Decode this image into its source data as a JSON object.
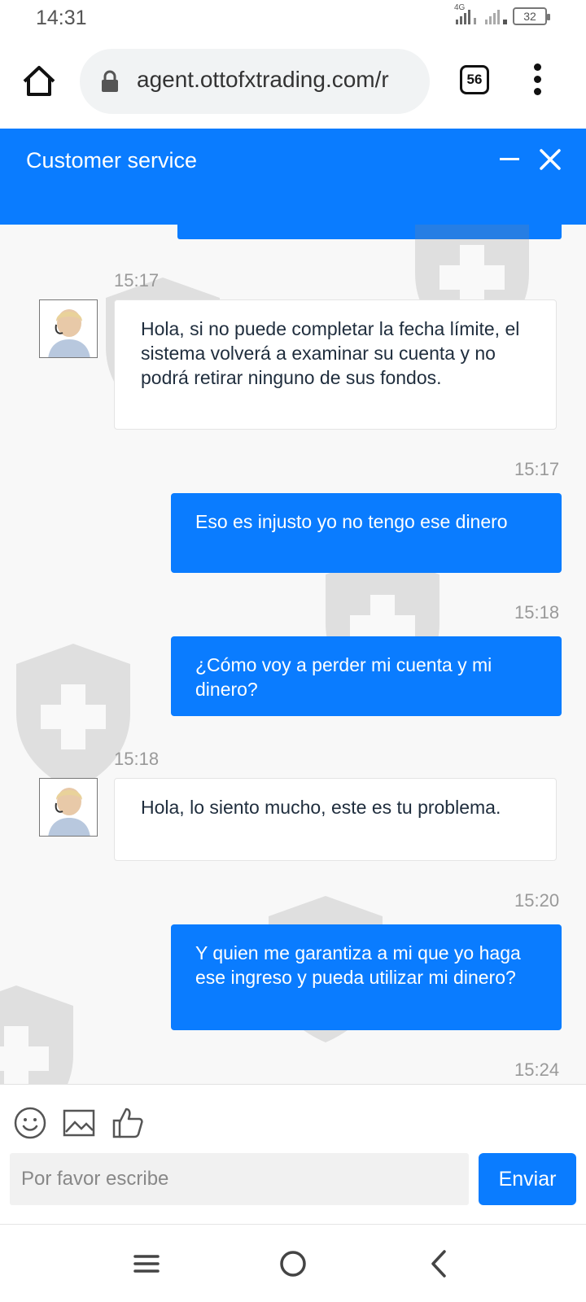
{
  "status_bar": {
    "time": "14:31",
    "network_label": "4G",
    "battery": "32"
  },
  "browser": {
    "url": "agent.ottofxtrading.com/r",
    "tab_count": "56"
  },
  "chat": {
    "title": "Customer service",
    "messages": [
      {
        "direction": "incoming",
        "time": "15:17",
        "text": "Hola, si no puede completar la fecha límite, el sistema volverá a examinar su cuenta y no podrá retirar ninguno de sus fondos."
      },
      {
        "direction": "outgoing",
        "time": "15:17",
        "text": "Eso es injusto yo no tengo ese dinero"
      },
      {
        "direction": "outgoing",
        "time": "15:18",
        "text": "¿Cómo voy a perder mi cuenta y mi dinero?"
      },
      {
        "direction": "incoming",
        "time": "15:18",
        "text": "Hola, lo siento mucho, este es tu problema."
      },
      {
        "direction": "outgoing",
        "time": "15:20",
        "text": "Y quien me garantiza a mi que yo haga ese ingreso y pueda utilizar mi dinero?"
      },
      {
        "direction": "outgoing",
        "time": "15:24",
        "text": ""
      }
    ]
  },
  "composer": {
    "placeholder": "Por favor escribe",
    "value": "",
    "send_label": "Enviar",
    "tools": [
      "emoji-icon",
      "image-icon",
      "thumbs-up-icon"
    ]
  },
  "nav": {
    "icons": [
      "recent-apps-icon",
      "home-circle-icon",
      "back-icon"
    ]
  },
  "colors": {
    "accent": "#0a7cff",
    "background": "#f8f8f8",
    "incoming_bubble": "#ffffff"
  }
}
